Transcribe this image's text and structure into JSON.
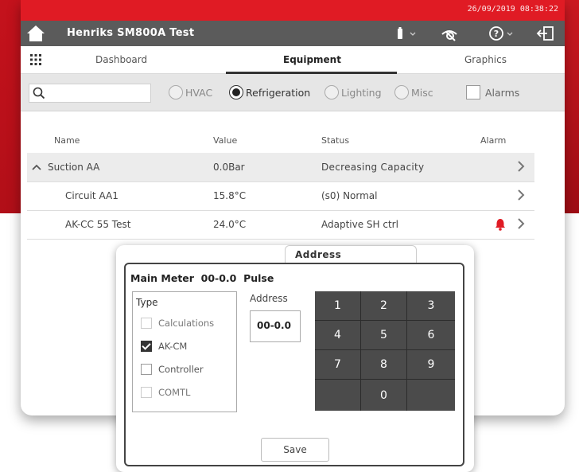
{
  "statusbar": {
    "datetime": "26/09/2019 08:38:22"
  },
  "header": {
    "title": "Henriks SM800A Test"
  },
  "tabs": [
    {
      "label": "Dashboard"
    },
    {
      "label": "Equipment"
    },
    {
      "label": "Graphics"
    }
  ],
  "filter": {
    "search_value": "",
    "options": [
      {
        "label": "HVAC",
        "selected": false
      },
      {
        "label": "Refrigeration",
        "selected": true
      },
      {
        "label": "Lighting",
        "selected": false
      },
      {
        "label": "Misc",
        "selected": false
      }
    ],
    "alarms_label": "Alarms"
  },
  "table": {
    "headers": {
      "name": "Name",
      "value": "Value",
      "status": "Status",
      "alarm": "Alarm"
    },
    "rows": [
      {
        "name": "Suction AA",
        "value": "0.0Bar",
        "status": "Decreasing Capacity",
        "alarm": false
      },
      {
        "name": "Circuit AA1",
        "value": "15.8°C",
        "status": "(s0) Normal",
        "alarm": false
      },
      {
        "name": "AK-CC 55 Test",
        "value": "24.0°C",
        "status": "Adaptive SH ctrl",
        "alarm": true
      }
    ]
  },
  "address_tab": {
    "label": "Address"
  },
  "dialog": {
    "title": "Main Meter  00-0.0  Pulse",
    "type_label": "Type",
    "types": [
      {
        "label": "Calculations",
        "checked": false,
        "enabled": false
      },
      {
        "label": "AK-CM",
        "checked": true,
        "enabled": true
      },
      {
        "label": "Controller",
        "checked": false,
        "enabled": true
      },
      {
        "label": "COMTL",
        "checked": false,
        "enabled": false
      }
    ],
    "address_label": "Address",
    "address_value": "00-0.0",
    "keys": [
      "1",
      "2",
      "3",
      "4",
      "5",
      "6",
      "7",
      "8",
      "9",
      "",
      "0",
      ""
    ],
    "save_label": "Save"
  },
  "colors": {
    "brand_red": "#e01b24",
    "header_gray": "#5b5b5b",
    "alarm_red": "#e01b24"
  }
}
